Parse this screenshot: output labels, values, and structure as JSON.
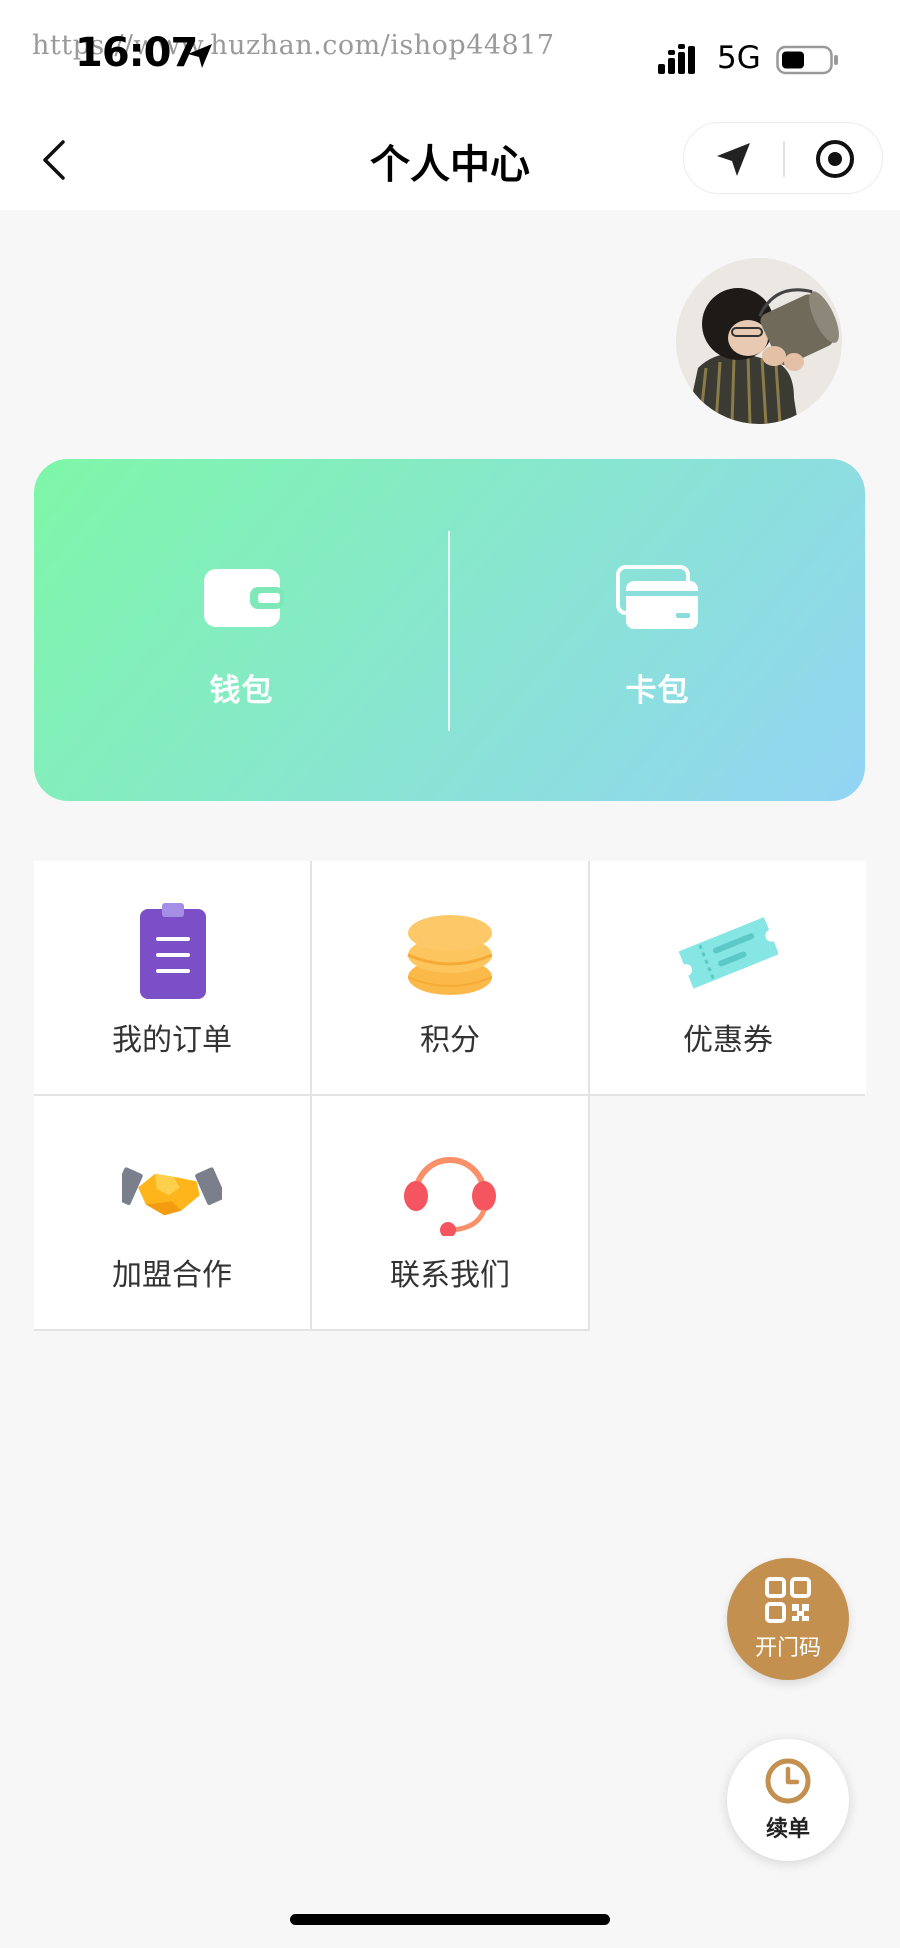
{
  "status_bar": {
    "time": "16:07",
    "network": "5G",
    "watermark": "https://www.huzhan.com/ishop44817"
  },
  "nav": {
    "title": "个人中心"
  },
  "wallet_card": {
    "items": [
      {
        "label": "钱包",
        "icon": "wallet-icon"
      },
      {
        "label": "卡包",
        "icon": "card-icon"
      }
    ],
    "colors": {
      "start": "#7ef7a8",
      "end": "#93d4f4"
    }
  },
  "menu": {
    "items": [
      {
        "label": "我的订单",
        "icon": "order-clipboard-icon"
      },
      {
        "label": "积分",
        "icon": "coins-icon"
      },
      {
        "label": "优惠券",
        "icon": "coupon-icon"
      },
      {
        "label": "加盟合作",
        "icon": "handshake-icon"
      },
      {
        "label": "联系我们",
        "icon": "headset-icon"
      }
    ]
  },
  "floating": {
    "open_door": {
      "label": "开门码",
      "icon": "qrcode-icon",
      "color": "#c39050"
    },
    "renew": {
      "label": "续单",
      "icon": "clock-icon",
      "color": "#c39050"
    }
  }
}
